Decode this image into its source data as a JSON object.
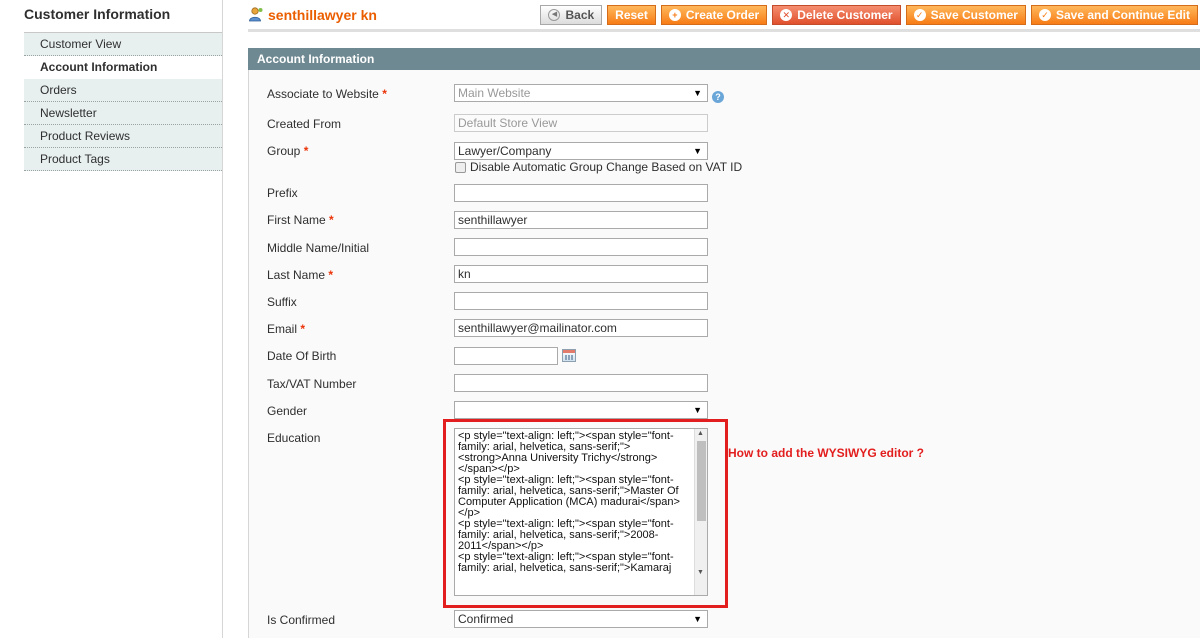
{
  "sidebar": {
    "title": "Customer Information",
    "tabs": [
      {
        "label": "Customer View"
      },
      {
        "label": "Account Information"
      },
      {
        "label": "Orders"
      },
      {
        "label": "Newsletter"
      },
      {
        "label": "Product Reviews"
      },
      {
        "label": "Product Tags"
      }
    ]
  },
  "header": {
    "title": "senthillawyer kn",
    "buttons": {
      "back": "Back",
      "reset": "Reset",
      "create_order": "Create Order",
      "delete_customer": "Delete Customer",
      "save_customer": "Save Customer",
      "save_continue": "Save and Continue Edit"
    }
  },
  "section": {
    "title": "Account Information"
  },
  "form": {
    "associate_website": {
      "label": "Associate to Website",
      "value": "Main Website"
    },
    "created_from": {
      "label": "Created From",
      "value": "Default Store View"
    },
    "group": {
      "label": "Group",
      "value": "Lawyer/Company",
      "checkbox_label": "Disable Automatic Group Change Based on VAT ID"
    },
    "prefix": {
      "label": "Prefix",
      "value": ""
    },
    "first_name": {
      "label": "First Name",
      "value": "senthillawyer"
    },
    "middle_name": {
      "label": "Middle Name/Initial",
      "value": ""
    },
    "last_name": {
      "label": "Last Name",
      "value": "kn"
    },
    "suffix": {
      "label": "Suffix",
      "value": ""
    },
    "email": {
      "label": "Email",
      "value": "senthillawyer@mailinator.com"
    },
    "dob": {
      "label": "Date Of Birth",
      "value": ""
    },
    "taxvat": {
      "label": "Tax/VAT Number",
      "value": ""
    },
    "gender": {
      "label": "Gender",
      "value": ""
    },
    "education": {
      "label": "Education",
      "value": "<p style=\"text-align: left;\"><span style=\"font-family: arial, helvetica, sans-serif;\"><strong>Anna University Trichy</strong></span></p>\n<p style=\"text-align: left;\"><span style=\"font-family: arial, helvetica, sans-serif;\">Master Of Computer Application (MCA) madurai</span></p>\n<p style=\"text-align: left;\"><span style=\"font-family: arial, helvetica, sans-serif;\">2008-2011</span></p>\n<p style=\"text-align: left;\"><span style=\"font-family: arial, helvetica, sans-serif;\">Kamaraj"
    },
    "is_confirmed": {
      "label": "Is Confirmed",
      "value": "Confirmed"
    },
    "required_mark": "*",
    "help_mark": "?"
  },
  "annotation": "How to add the WYSIWYG editor ?",
  "colors": {
    "accent": "#eb5e00",
    "section_header": "#6f8992",
    "highlight": "#e31e1e"
  }
}
